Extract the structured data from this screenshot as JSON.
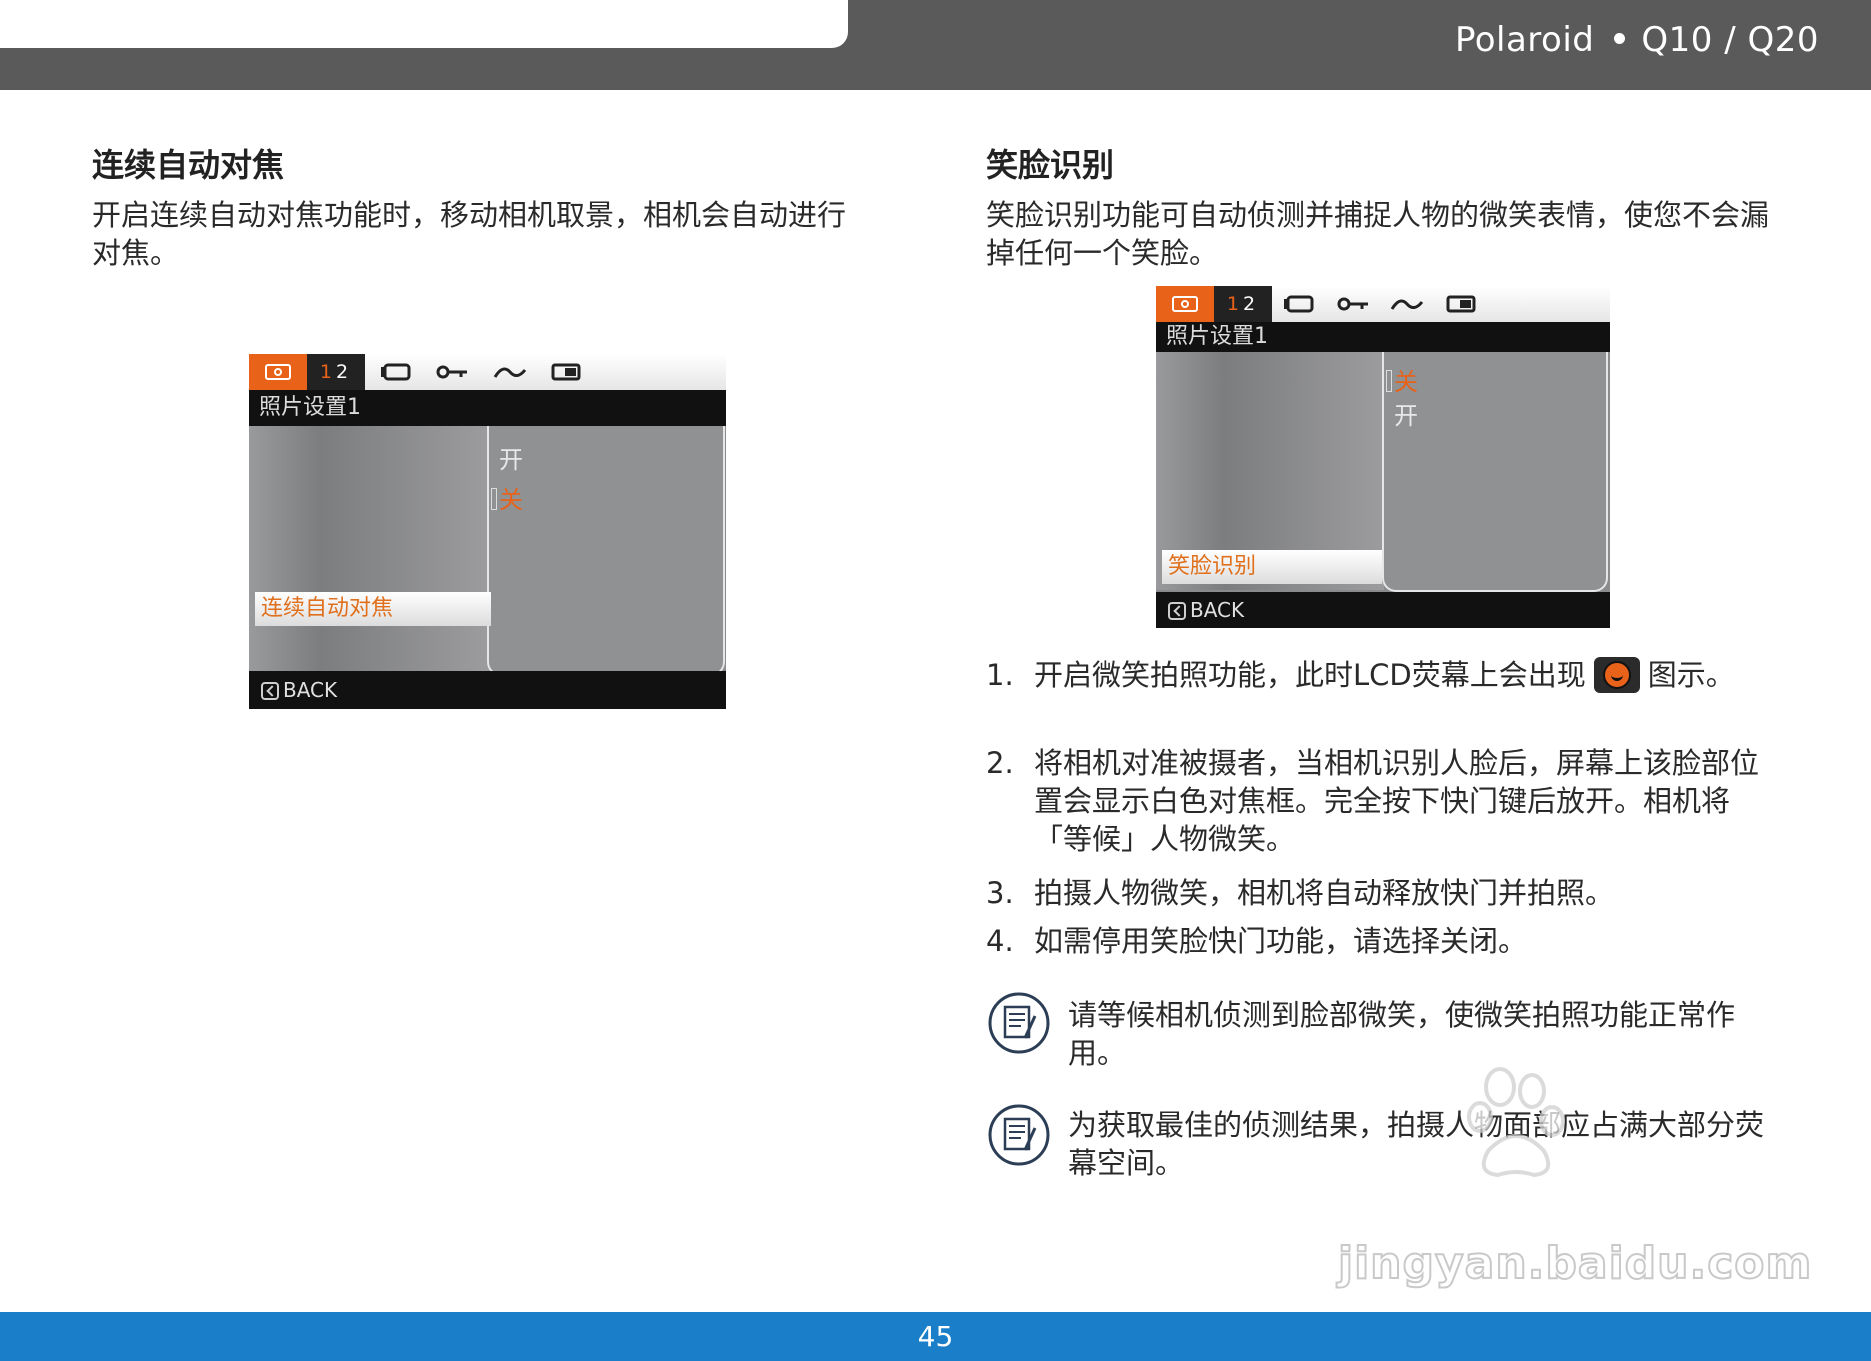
{
  "header": {
    "brand": "Polaroid",
    "model": "Q10 / Q20"
  },
  "left": {
    "title": "连续自动对焦",
    "body": "开启连续自动对焦功能时，移动相机取景，相机会自动进行对焦。",
    "lcd": {
      "page_tab": {
        "p1": "1",
        "p2": "2"
      },
      "menu_title": "照片设置1",
      "options": [
        "开",
        "关"
      ],
      "selected_option_index": 1,
      "selected_item": "连续自动对焦",
      "back": "BACK"
    }
  },
  "right": {
    "title": "笑脸识别",
    "body": "笑脸识别功能可自动侦测并捕捉人物的微笑表情，使您不会漏掉任何一个笑脸。",
    "lcd": {
      "page_tab": {
        "p1": "1",
        "p2": "2"
      },
      "menu_title": "照片设置1",
      "options": [
        "关",
        "开"
      ],
      "selected_option_index": 0,
      "selected_item": "笑脸识别",
      "back": "BACK"
    },
    "steps": [
      {
        "num": "1.",
        "text_before": "开启微笑拍照功能，此时LCD荧幕上会出现",
        "icon": "smile-shutter-icon",
        "text_after": "图示。"
      },
      {
        "num": "2.",
        "text": "将相机对准被摄者，当相机识别人脸后，屏幕上该脸部位置会显示白色对焦框。完全按下快门键后放开。相机将「等候」人物微笑。"
      },
      {
        "num": "3.",
        "text": "拍摄人物微笑，相机将自动释放快门并拍照。"
      },
      {
        "num": "4.",
        "text": "如需停用笑脸快门功能，请选择关闭。"
      }
    ],
    "notes": [
      {
        "icon": "note-icon",
        "text": "请等候相机侦测到脸部微笑，使微笑拍照功能正常作用。"
      },
      {
        "icon": "note-icon",
        "text": "为获取最佳的侦测结果，拍摄人物面部应占满大部分荧幕空间。"
      }
    ]
  },
  "watermark": {
    "logo": "Bai du 经验",
    "url": "jingyan.baidu.com"
  },
  "footer": {
    "page": "45"
  },
  "colors": {
    "accent": "#e8621a",
    "footer_blue": "#1a7fc8",
    "header_gray": "#5a5a5b"
  }
}
